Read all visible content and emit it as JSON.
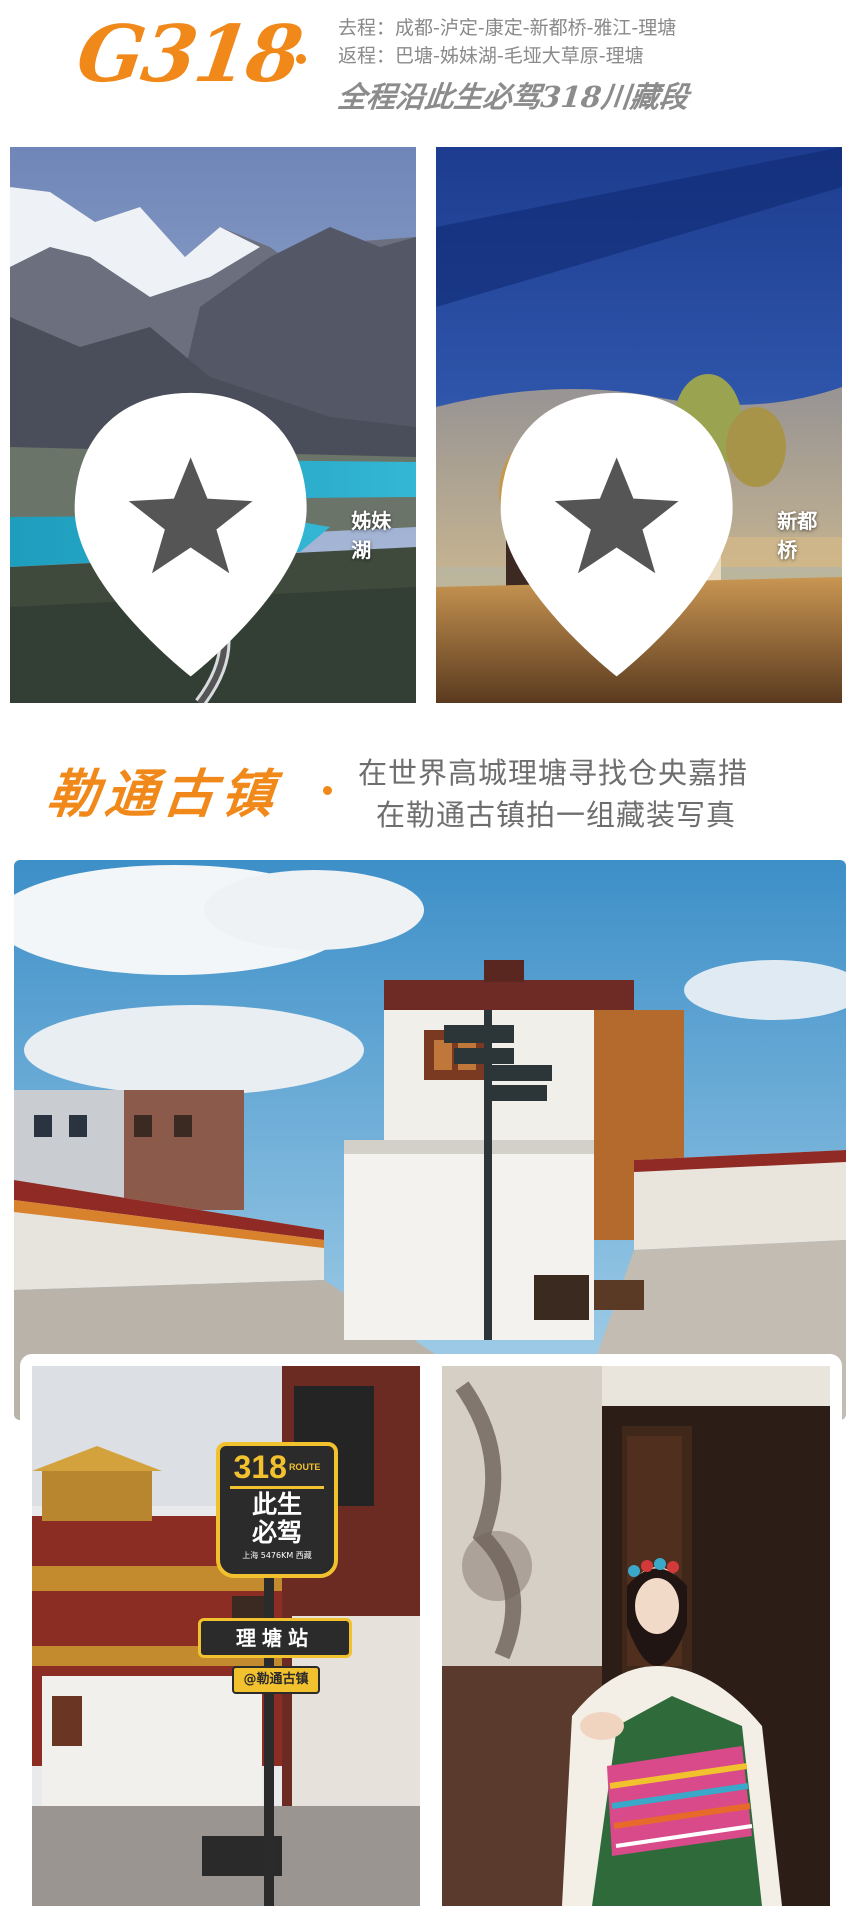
{
  "header": {
    "logo_text": "G318",
    "route_out": "去程：成都-泸定-康定-新都桥-雅江-理塘",
    "route_back": "返程：巴塘-姊妹湖-毛垭大草原-理塘",
    "tagline": "全程沿此生必驾318川藏段"
  },
  "photos_top": [
    {
      "location": "姊妹湖",
      "icon": "map-pin-icon"
    },
    {
      "location": "新都桥",
      "icon": "map-pin-icon"
    }
  ],
  "section_town": {
    "title": "勒通古镇",
    "line1": "在世界高城理塘寻找仓央嘉措",
    "line2": "在勒通古镇拍一组藏装写真"
  },
  "sign": {
    "route_number": "318",
    "route_word": "ROUTE",
    "line1": "此生",
    "line2": "必驾",
    "distance": "上海 5476KM 西藏",
    "station": "理塘站",
    "town_tag": "@勒通古镇"
  },
  "colors": {
    "accent_orange": "#f0891a",
    "text_gray": "#8a8a8a",
    "sign_yellow": "#f2c12e",
    "sign_dark": "#2b2b2b"
  }
}
